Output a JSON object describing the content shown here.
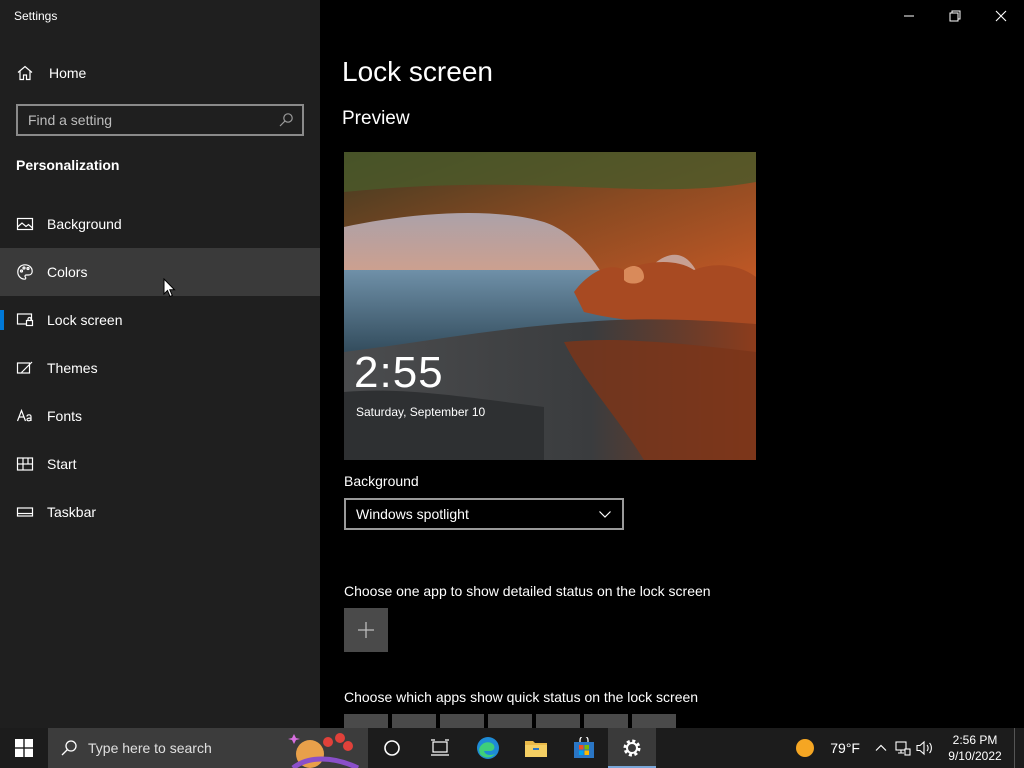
{
  "window": {
    "title": "Settings",
    "controls": [
      "minimize",
      "restore",
      "close"
    ]
  },
  "sidebar": {
    "home_label": "Home",
    "search_placeholder": "Find a setting",
    "section_title": "Personalization",
    "items": [
      {
        "label": "Background",
        "icon": "image-icon"
      },
      {
        "label": "Colors",
        "icon": "palette-icon"
      },
      {
        "label": "Lock screen",
        "icon": "lock-screen-icon"
      },
      {
        "label": "Themes",
        "icon": "brush-icon"
      },
      {
        "label": "Fonts",
        "icon": "font-icon"
      },
      {
        "label": "Start",
        "icon": "start-layout-icon"
      },
      {
        "label": "Taskbar",
        "icon": "taskbar-icon"
      }
    ],
    "selected_item": "Lock screen",
    "hovered_item": "Colors"
  },
  "main": {
    "page_title": "Lock screen",
    "preview_title": "Preview",
    "preview": {
      "time": "2:55",
      "date": "Saturday, September 10"
    },
    "background_label": "Background",
    "background_value": "Windows spotlight",
    "detailed_status_label": "Choose one app to show detailed status on the lock screen",
    "quick_status_label": "Choose which apps show quick status on the lock screen"
  },
  "taskbar": {
    "search_placeholder": "Type here to search",
    "apps": [
      "cortana-icon",
      "task-view-icon",
      "edge-icon",
      "file-explorer-icon",
      "store-icon",
      "settings-icon"
    ],
    "active_app": "settings-icon",
    "weather": "79°F",
    "time": "2:56 PM",
    "date": "9/10/2022"
  },
  "colors": {
    "accent": "#0078d7",
    "sidebar_bg": "#1f1f1f",
    "main_bg": "#000000",
    "hover_bg": "#3a3a3a"
  }
}
